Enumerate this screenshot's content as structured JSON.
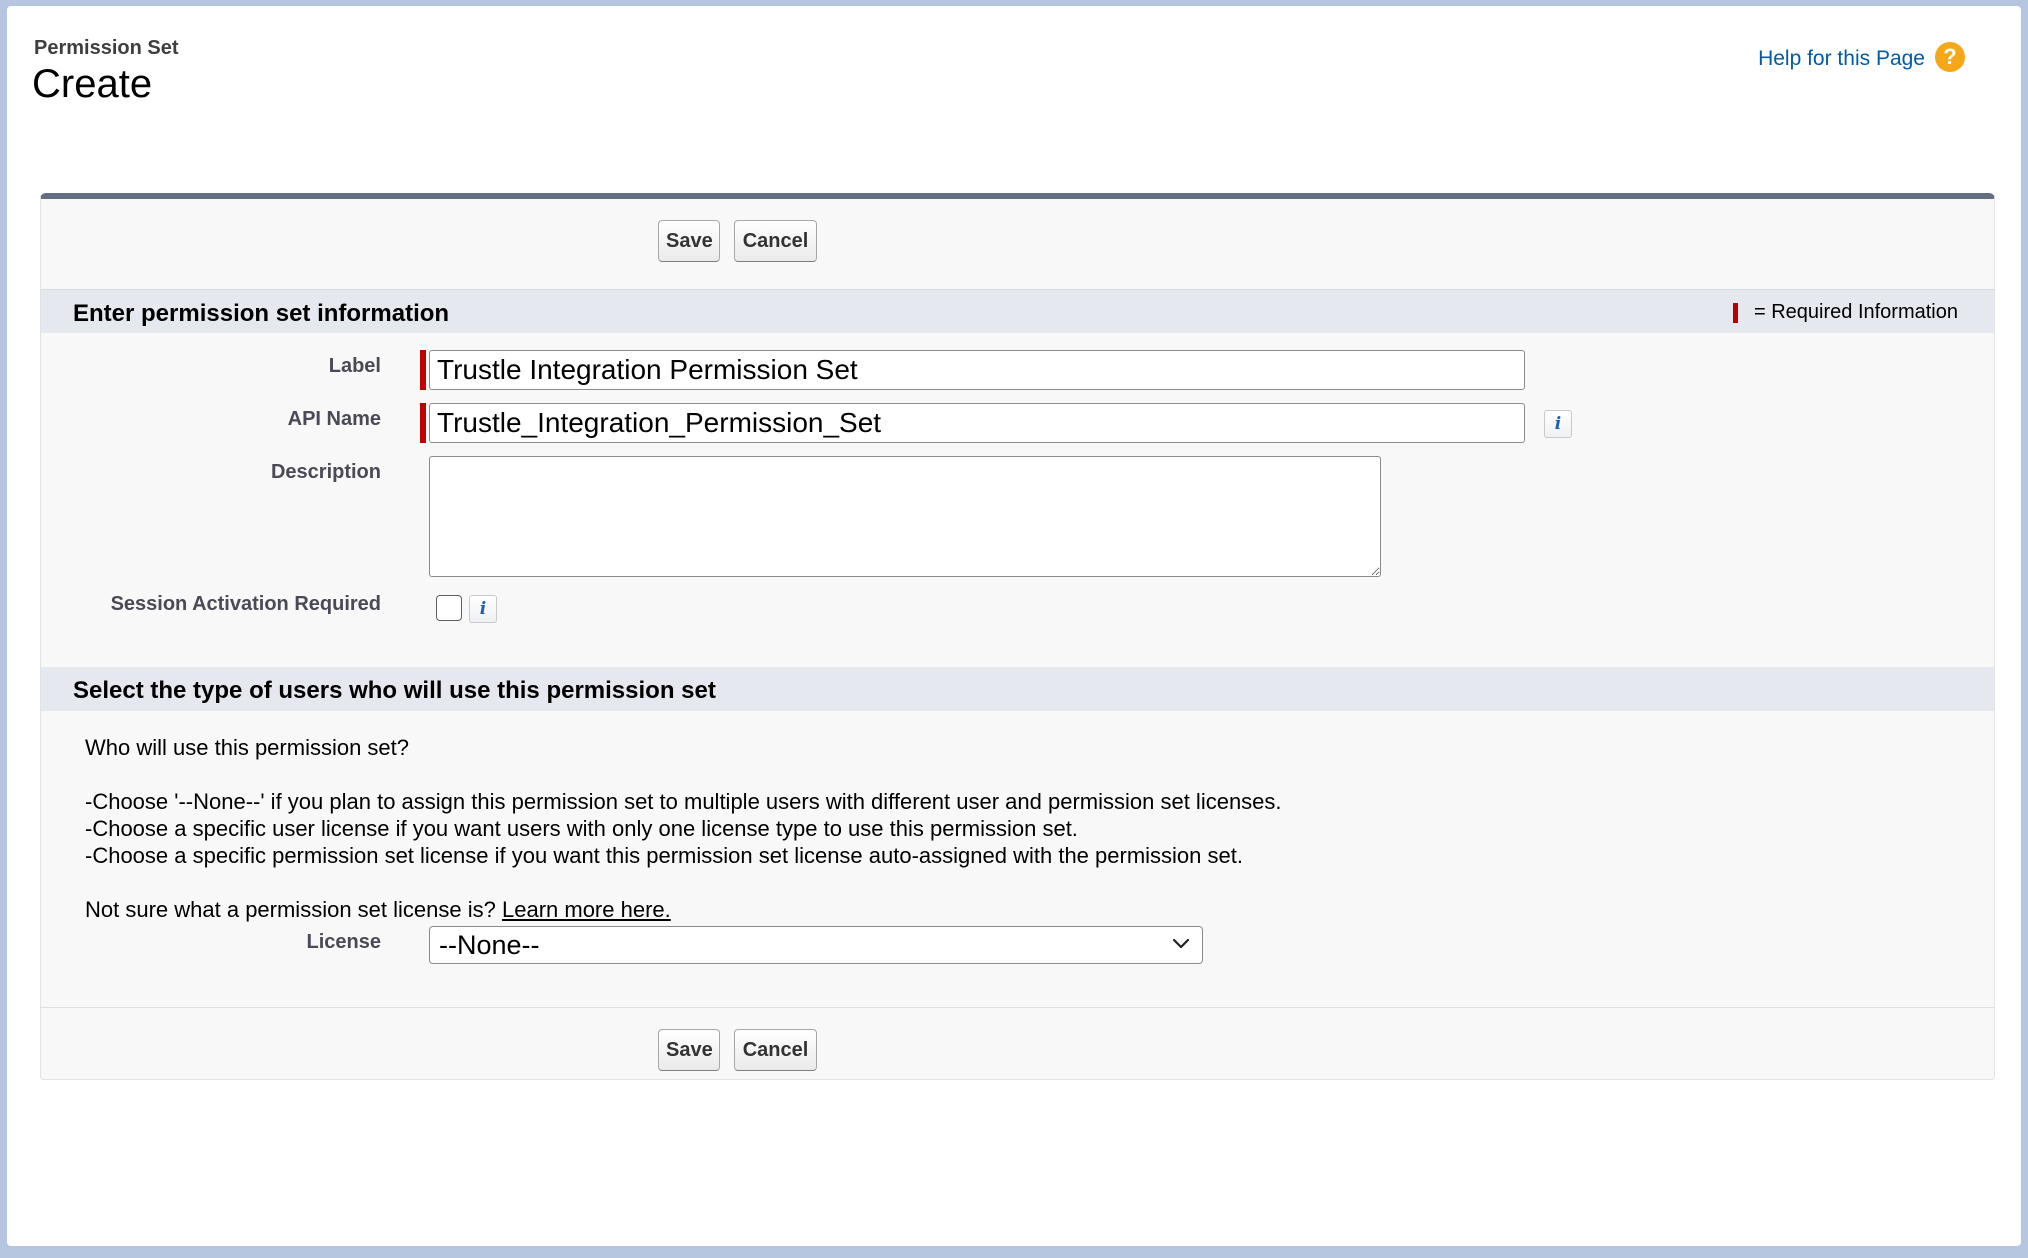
{
  "header": {
    "eyebrow": "Permission Set",
    "title": "Create",
    "help_link": "Help for this Page",
    "help_icon": "?"
  },
  "toolbar": {
    "save_label": "Save",
    "cancel_label": "Cancel"
  },
  "section_info": {
    "title": "Enter permission set information",
    "required_legend": "= Required Information",
    "label_field": {
      "label": "Label",
      "value": "Trustle Integration Permission Set"
    },
    "api_name_field": {
      "label": "API Name",
      "value": "Trustle_Integration_Permission_Set"
    },
    "description_field": {
      "label": "Description",
      "value": ""
    },
    "session_activation": {
      "label": "Session Activation Required",
      "checked": false
    },
    "info_icon_glyph": "i"
  },
  "section_users": {
    "title": "Select the type of users who will use this permission set",
    "question": "Who will use this permission set?",
    "lines": [
      "-Choose '--None--' if you plan to assign this permission set to multiple users with different user and permission set licenses.",
      "-Choose a specific user license if you want users with only one license type to use this permission set.",
      "-Choose a specific permission set license if you want this permission set license auto-assigned with the permission set."
    ],
    "note_prefix": "Not sure what a permission set license is?",
    "learn_more": "Learn more here.",
    "license_field": {
      "label": "License",
      "selected": "--None--"
    }
  },
  "colors": {
    "required_red": "#c00000",
    "link_blue": "#015ba7",
    "help_orange": "#f4a819",
    "panel_top_border": "#636e82",
    "section_header_bg": "#e5e8ef"
  }
}
